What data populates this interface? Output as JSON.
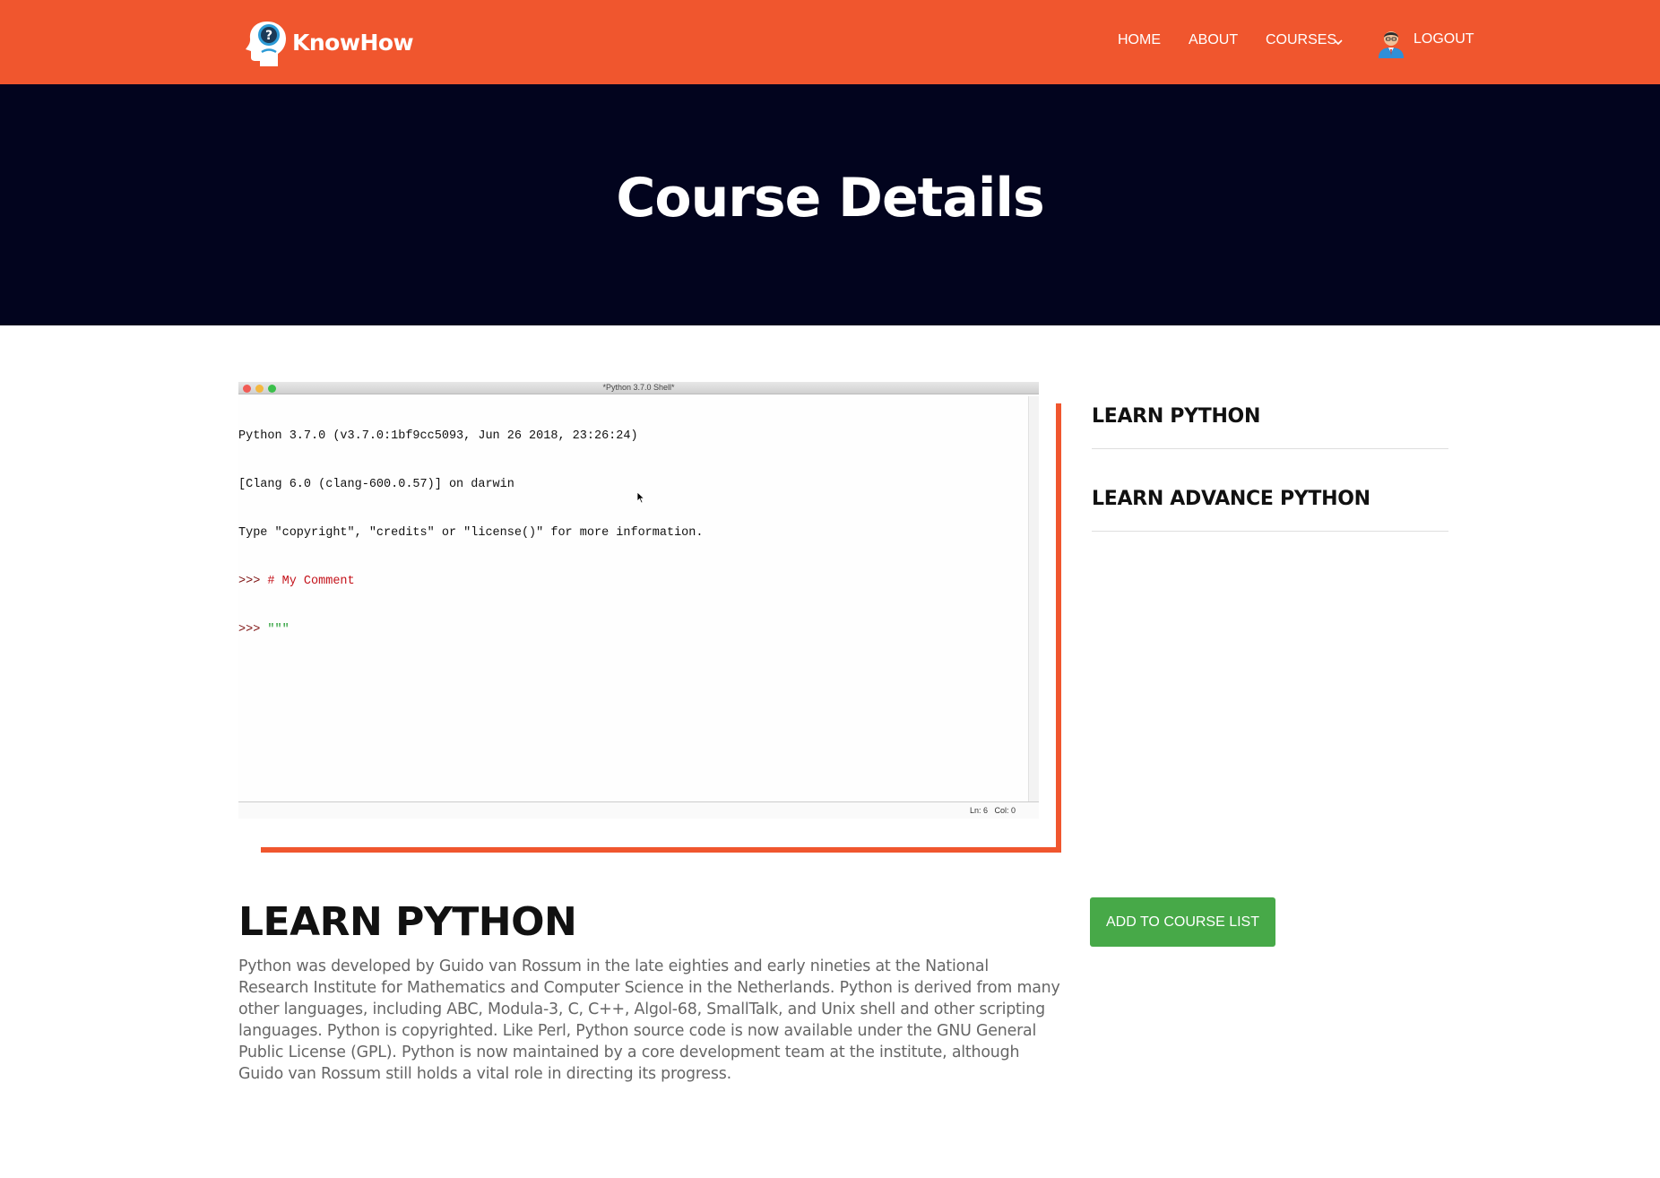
{
  "brand": {
    "name": "KnowHow",
    "colors": {
      "primary": "#f0562e",
      "hero_bg": "#02041e",
      "button": "#47a948"
    }
  },
  "nav": {
    "home": "HOME",
    "about": "ABOUT",
    "courses": "COURSES",
    "logout": "LOGOUT"
  },
  "hero": {
    "title": "Course Details"
  },
  "media": {
    "window_title": "*Python 3.7.0 Shell*",
    "lines": [
      "Python 3.7.0 (v3.7.0:1bf9cc5093, Jun 26 2018, 23:26:24)",
      "[Clang 6.0 (clang-600.0.57)] on darwin",
      "Type \"copyright\", \"credits\" or \"license()\" for more information."
    ],
    "prompt": ">>>",
    "comment": "# My Comment",
    "docstring": "\"\"\"",
    "status": "Ln: 6   Col: 0"
  },
  "sidebar": {
    "items": [
      {
        "label": "LEARN PYTHON"
      },
      {
        "label": "LEARN ADVANCE PYTHON"
      }
    ]
  },
  "course": {
    "title": "LEARN PYTHON",
    "description": "Python was developed by Guido van Rossum in the late eighties and early nineties at the National Research Institute for Mathematics and Computer Science in the Netherlands. Python is derived from many other languages, including ABC, Modula-3, C, C++, Algol-68, SmallTalk, and Unix shell and other scripting languages. Python is copyrighted. Like Perl, Python source code is now available under the GNU General Public License (GPL). Python is now maintained by a core development team at the institute, although Guido van Rossum still holds a vital role in directing its progress.",
    "add_button": "ADD TO COURSE LIST"
  }
}
